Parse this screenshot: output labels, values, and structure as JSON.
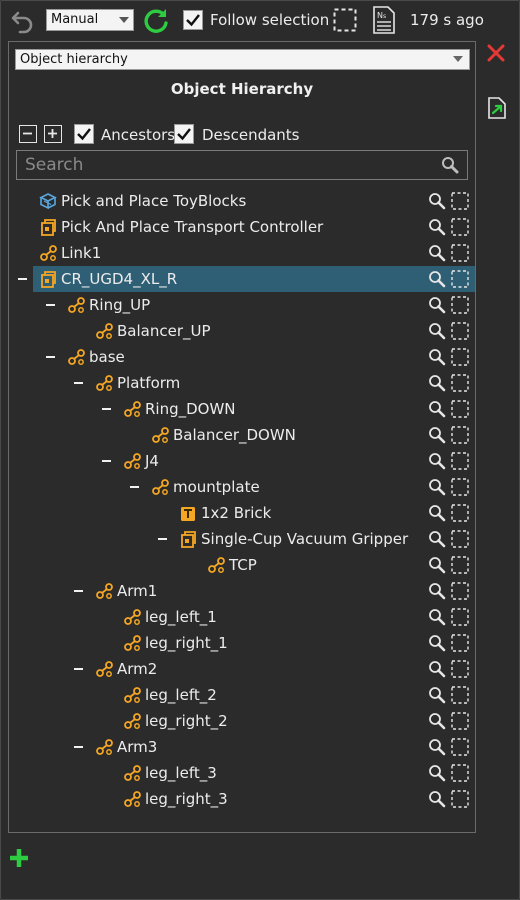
{
  "toolbar": {
    "mode": "Manual",
    "follow_selection_label": "Follow selection",
    "follow_selection_checked": true,
    "age_text": "179 s ago"
  },
  "panel": {
    "view_select": "Object hierarchy",
    "title": "Object Hierarchy",
    "ancestors_label": "Ancestors",
    "descendants_label": "Descendants",
    "ancestors_checked": true,
    "descendants_checked": true,
    "search_placeholder": "Search"
  },
  "tree": [
    {
      "label": "Pick and Place ToyBlocks",
      "depth": 0,
      "icon": "cube-blue-icon",
      "collapsible": false
    },
    {
      "label": "Pick And Place Transport Controller",
      "depth": 0,
      "icon": "component-icon",
      "collapsible": false
    },
    {
      "label": "Link1",
      "depth": 0,
      "icon": "link-icon",
      "collapsible": false
    },
    {
      "label": "CR_UGD4_XL_R",
      "depth": 0,
      "icon": "component-icon",
      "collapsible": true,
      "selected": true
    },
    {
      "label": "Ring_UP",
      "depth": 1,
      "icon": "link-icon",
      "collapsible": true
    },
    {
      "label": "Balancer_UP",
      "depth": 2,
      "icon": "link-icon",
      "collapsible": false
    },
    {
      "label": "base",
      "depth": 1,
      "icon": "link-icon",
      "collapsible": true
    },
    {
      "label": "Platform",
      "depth": 2,
      "icon": "link-icon",
      "collapsible": true
    },
    {
      "label": "Ring_DOWN",
      "depth": 3,
      "icon": "link-icon",
      "collapsible": true
    },
    {
      "label": "Balancer_DOWN",
      "depth": 4,
      "icon": "link-icon",
      "collapsible": false
    },
    {
      "label": "J4",
      "depth": 3,
      "icon": "link-icon",
      "collapsible": true
    },
    {
      "label": "mountplate",
      "depth": 4,
      "icon": "link-icon",
      "collapsible": true
    },
    {
      "label": "1x2 Brick",
      "depth": 5,
      "icon": "brick-icon",
      "collapsible": false
    },
    {
      "label": "Single-Cup Vacuum Gripper",
      "depth": 5,
      "icon": "component-icon",
      "collapsible": true
    },
    {
      "label": "TCP",
      "depth": 6,
      "icon": "link-icon",
      "collapsible": false
    },
    {
      "label": "Arm1",
      "depth": 2,
      "icon": "link-icon",
      "collapsible": true
    },
    {
      "label": "leg_left_1",
      "depth": 3,
      "icon": "link-icon",
      "collapsible": false
    },
    {
      "label": "leg_right_1",
      "depth": 3,
      "icon": "link-icon",
      "collapsible": false
    },
    {
      "label": "Arm2",
      "depth": 2,
      "icon": "link-icon",
      "collapsible": true
    },
    {
      "label": "leg_left_2",
      "depth": 3,
      "icon": "link-icon",
      "collapsible": false
    },
    {
      "label": "leg_right_2",
      "depth": 3,
      "icon": "link-icon",
      "collapsible": false
    },
    {
      "label": "Arm3",
      "depth": 2,
      "icon": "link-icon",
      "collapsible": true
    },
    {
      "label": "leg_left_3",
      "depth": 3,
      "icon": "link-icon",
      "collapsible": false
    },
    {
      "label": "leg_right_3",
      "depth": 3,
      "icon": "link-icon",
      "collapsible": false
    }
  ],
  "colors": {
    "background": "#2b2b2b",
    "selected_row": "#2f5f75",
    "node_icon": "#f5a623",
    "refresh": "#2ecc40",
    "close": "#e53935",
    "add": "#2ecc40"
  }
}
